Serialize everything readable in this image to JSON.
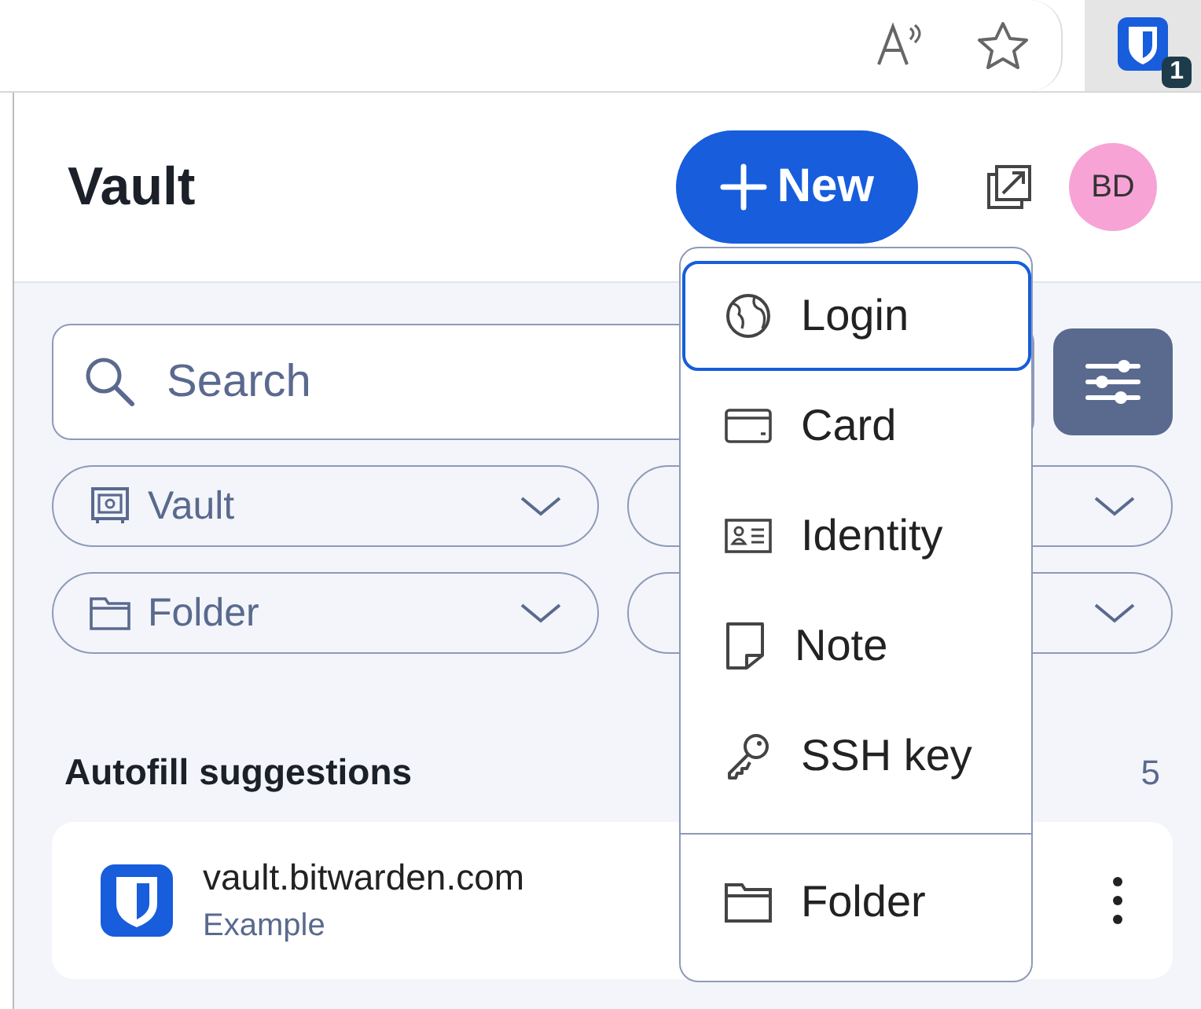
{
  "browser_toolbar": {
    "extension_badge": "1"
  },
  "header": {
    "title": "Vault",
    "new_button": "New",
    "avatar": "BD"
  },
  "search": {
    "placeholder": "Search"
  },
  "filters": [
    {
      "label": "Vault",
      "kind": "vault"
    },
    {
      "kind": "covered"
    },
    {
      "label": "Folder",
      "kind": "folder"
    },
    {
      "kind": "covered"
    }
  ],
  "section": {
    "title": "Autofill suggestions",
    "count": "5"
  },
  "items": [
    {
      "name": "vault.bitwarden.com",
      "subtitle": "Example"
    }
  ],
  "new_menu": [
    {
      "label": "Login",
      "kind": "login",
      "selected": true
    },
    {
      "label": "Card",
      "kind": "card",
      "selected": false
    },
    {
      "label": "Identity",
      "kind": "identity",
      "selected": false
    },
    {
      "label": "Note",
      "kind": "note",
      "selected": false
    },
    {
      "label": "SSH key",
      "kind": "key",
      "selected": false
    },
    {
      "label": "Folder",
      "kind": "folder",
      "selected": false,
      "divider_before": true
    }
  ]
}
